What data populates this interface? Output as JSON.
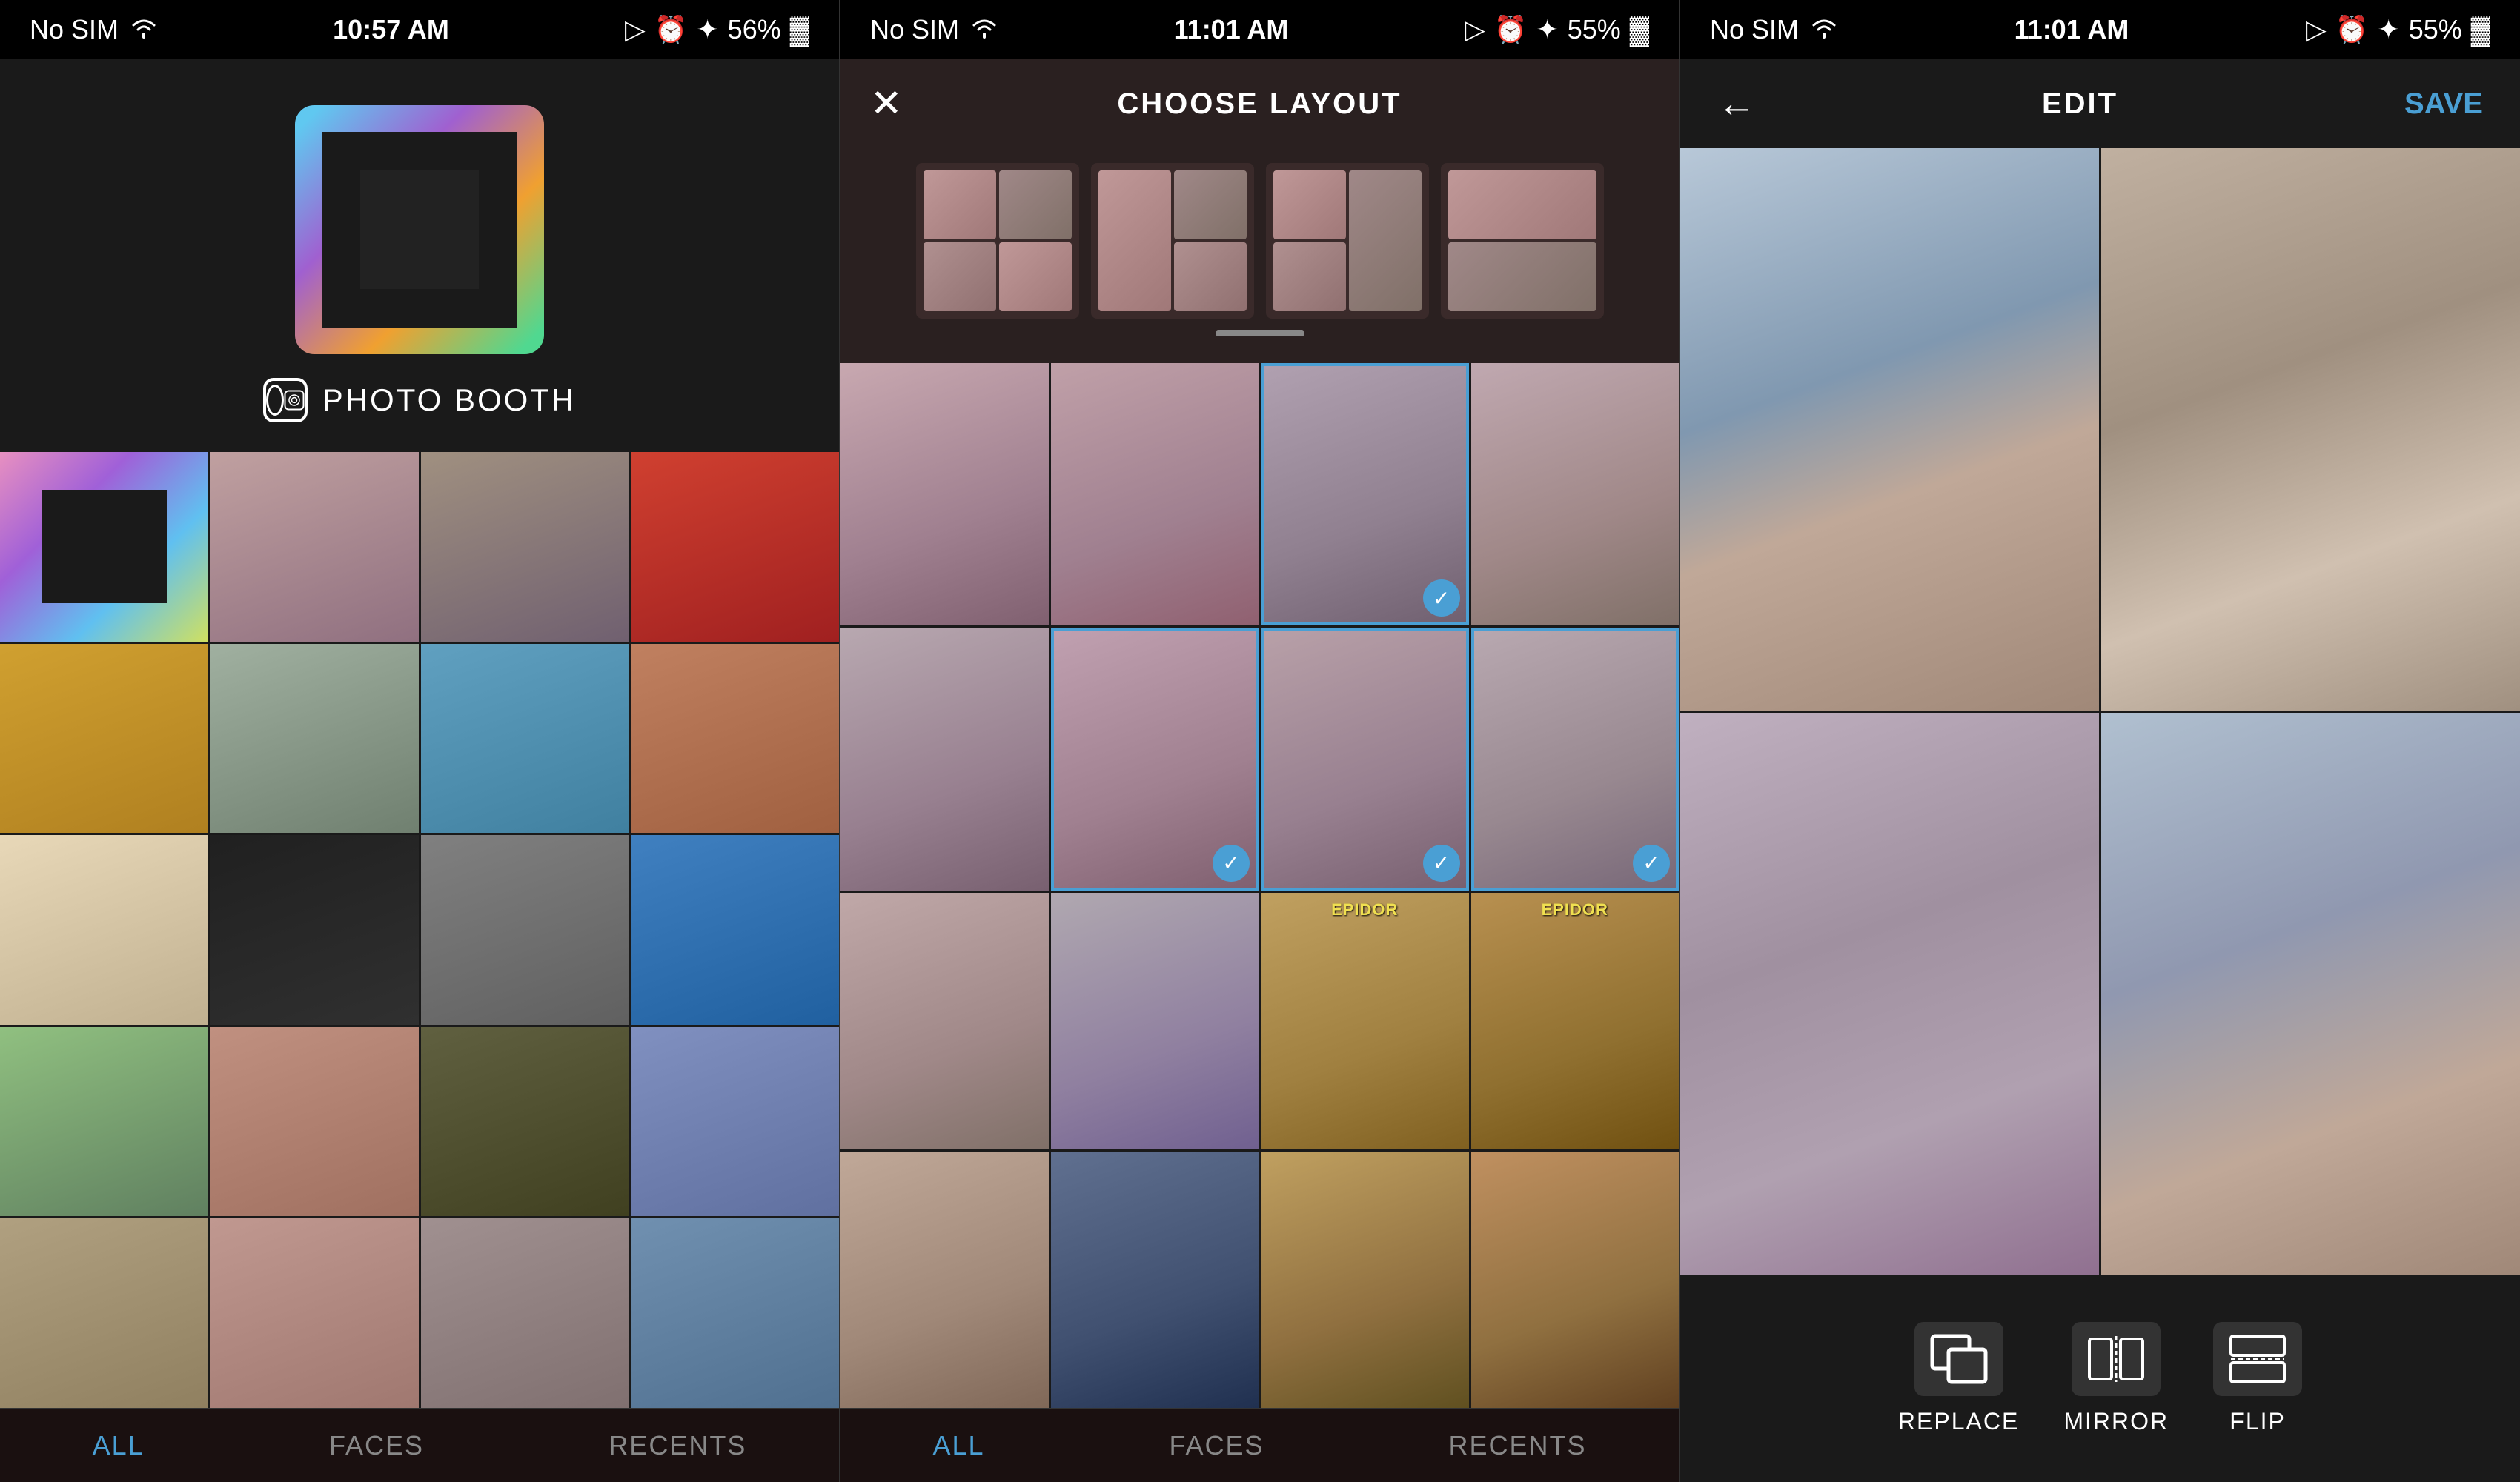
{
  "panels": [
    {
      "id": "panel-1",
      "status": {
        "nosim": "No SIM",
        "wifi": "wifi",
        "time": "10:57 AM",
        "location": "location",
        "alarm": "alarm",
        "bt": "bluetooth",
        "battery_pct": "56%",
        "battery": "battery"
      },
      "app_name": "PHOTO BOOTH",
      "tabs": [
        {
          "label": "ALL",
          "active": true
        },
        {
          "label": "FACES",
          "active": false
        },
        {
          "label": "RECENTS",
          "active": false
        }
      ]
    },
    {
      "id": "panel-2",
      "status": {
        "nosim": "No SIM",
        "time": "11:01 AM",
        "battery_pct": "55%"
      },
      "header": {
        "close_label": "✕",
        "title": "CHOOSE LAYOUT"
      },
      "tabs": [
        {
          "label": "ALL",
          "active": true
        },
        {
          "label": "FACES",
          "active": false
        },
        {
          "label": "RECENTS",
          "active": false
        }
      ]
    },
    {
      "id": "panel-3",
      "status": {
        "nosim": "No SIM",
        "time": "11:01 AM",
        "battery_pct": "55%"
      },
      "header": {
        "back_label": "←",
        "title": "EDIT",
        "save_label": "SAVE"
      },
      "toolbar": {
        "buttons": [
          {
            "id": "replace",
            "label": "REPLACE"
          },
          {
            "id": "mirror",
            "label": "MIRROR"
          },
          {
            "id": "flip",
            "label": "FLIP"
          }
        ]
      }
    }
  ]
}
